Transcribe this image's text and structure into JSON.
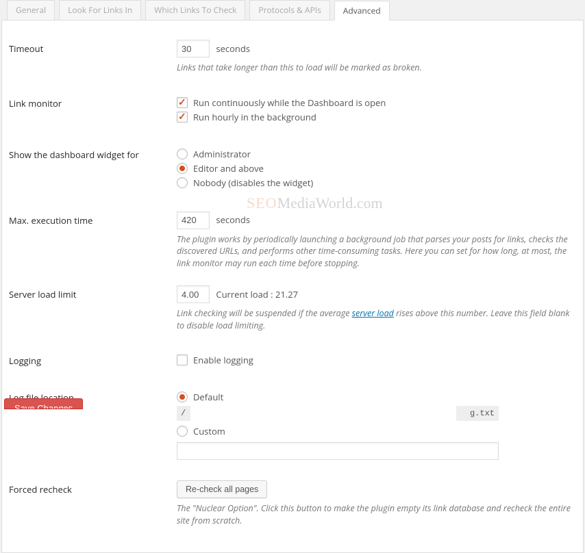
{
  "tabs": {
    "general": "General",
    "look": "Look For Links In",
    "which": "Which Links To Check",
    "protocols": "Protocols & APIs",
    "advanced": "Advanced"
  },
  "timeout": {
    "label": "Timeout",
    "value": "30",
    "unit": "seconds",
    "desc": "Links that take longer than this to load will be marked as broken."
  },
  "link_monitor": {
    "label": "Link monitor",
    "cont": "Run continuously while the Dashboard is open",
    "hourly": "Run hourly in the background"
  },
  "dashboard_widget": {
    "label": "Show the dashboard widget for",
    "admin": "Administrator",
    "editor": "Editor and above",
    "nobody": "Nobody (disables the widget)"
  },
  "max_exec": {
    "label": "Max. execution time",
    "value": "420",
    "unit": "seconds",
    "desc": "The plugin works by periodically launching a background job that parses your posts for links, checks the discovered URLs, and performs other time-consuming tasks. Here you can set for how long, at most, the link monitor may run each time before stopping."
  },
  "server_load": {
    "label": "Server load limit",
    "value": "4.00",
    "current_prefix": "Current load : ",
    "current_value": "21.27",
    "desc_before": "Link checking will be suspended if the average ",
    "desc_link": "server load",
    "desc_after": " rises above this number. Leave this field blank to disable load limiting."
  },
  "logging": {
    "label": "Logging",
    "enable": "Enable logging"
  },
  "logfile": {
    "label": "Log file location",
    "default": "Default",
    "path_left": "/",
    "path_right": "g.txt",
    "custom": "Custom"
  },
  "recheck": {
    "label": "Forced recheck",
    "button": "Re-check all pages",
    "desc": "The \"Nuclear Option\". Click this button to make the plugin empty its link database and recheck the entire site from scratch."
  },
  "save": "Save Changes",
  "watermark": {
    "seo": "SEO",
    "rest": "MediaWorld.com"
  }
}
